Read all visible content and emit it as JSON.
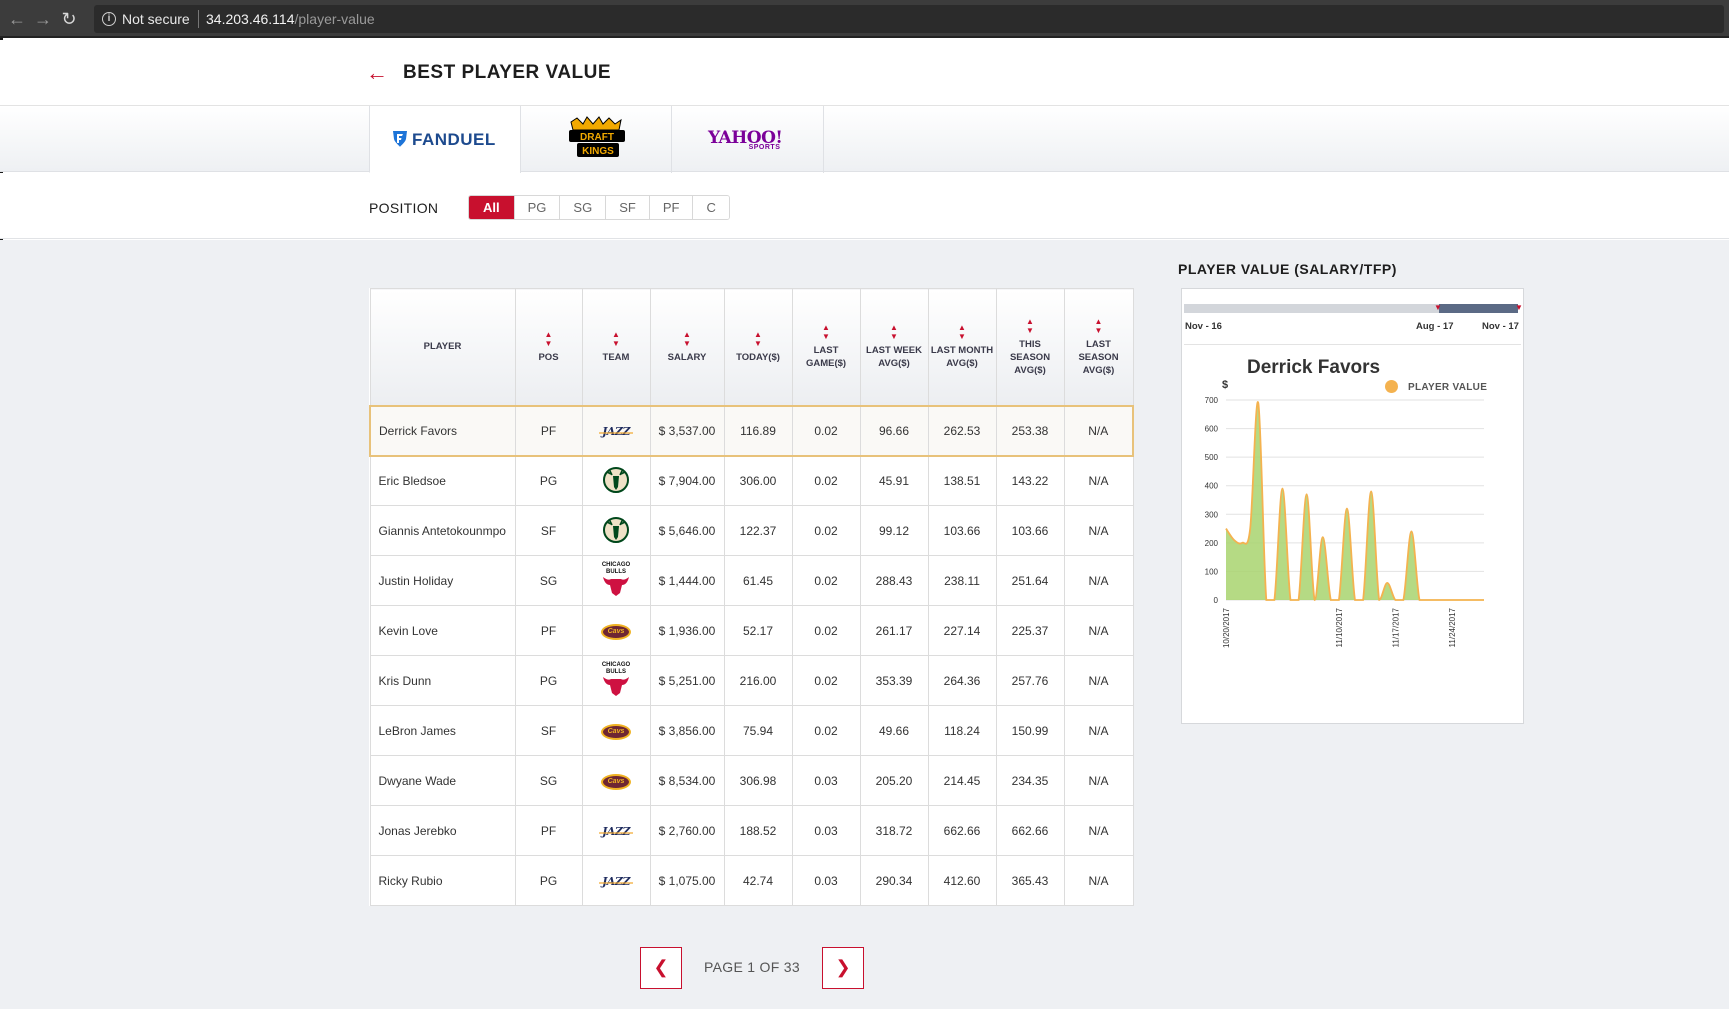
{
  "browser": {
    "security_label": "Not secure",
    "host": "34.203.46.114",
    "path": "/player-value"
  },
  "header": {
    "back_icon": "arrow-left-icon",
    "title": "BEST PLAYER VALUE"
  },
  "providers": [
    {
      "name": "FANDUEL",
      "active": true
    },
    {
      "name": "DRAFT KINGS",
      "active": false
    },
    {
      "name": "YAHOO!",
      "sub": "SPORTS",
      "active": false
    }
  ],
  "filter": {
    "label": "POSITION",
    "options": [
      "All",
      "PG",
      "SG",
      "SF",
      "PF",
      "C"
    ],
    "selected": "All"
  },
  "table": {
    "columns": [
      "PLAYER",
      "POS",
      "TEAM",
      "SALARY",
      "TODAY($)",
      "LAST GAME($)",
      "LAST WEEK AVG($)",
      "LAST MONTH AVG($)",
      "THIS SEASON AVG($)",
      "LAST SEASON AVG($)"
    ],
    "rows": [
      {
        "player": "Derrick Favors",
        "pos": "PF",
        "team": "jazz",
        "team_text": "JAZZ",
        "salary": "$ 3,537.00",
        "today": "116.89",
        "last_game": "0.02",
        "last_week": "96.66",
        "last_month": "262.53",
        "this_season": "253.38",
        "last_season": "N/A",
        "selected": true
      },
      {
        "player": "Eric Bledsoe",
        "pos": "PG",
        "team": "bucks",
        "team_text": "",
        "salary": "$ 7,904.00",
        "today": "306.00",
        "last_game": "0.02",
        "last_week": "45.91",
        "last_month": "138.51",
        "this_season": "143.22",
        "last_season": "N/A"
      },
      {
        "player": "Giannis Antetokounmpo",
        "pos": "SF",
        "team": "bucks",
        "team_text": "",
        "salary": "$ 5,646.00",
        "today": "122.37",
        "last_game": "0.02",
        "last_week": "99.12",
        "last_month": "103.66",
        "this_season": "103.66",
        "last_season": "N/A"
      },
      {
        "player": "Justin Holiday",
        "pos": "SG",
        "team": "bulls",
        "team_text": "CHICAGO BULLS",
        "salary": "$ 1,444.00",
        "today": "61.45",
        "last_game": "0.02",
        "last_week": "288.43",
        "last_month": "238.11",
        "this_season": "251.64",
        "last_season": "N/A"
      },
      {
        "player": "Kevin Love",
        "pos": "PF",
        "team": "cavs",
        "team_text": "Cavs",
        "salary": "$ 1,936.00",
        "today": "52.17",
        "last_game": "0.02",
        "last_week": "261.17",
        "last_month": "227.14",
        "this_season": "225.37",
        "last_season": "N/A"
      },
      {
        "player": "Kris Dunn",
        "pos": "PG",
        "team": "bulls",
        "team_text": "CHICAGO BULLS",
        "salary": "$ 5,251.00",
        "today": "216.00",
        "last_game": "0.02",
        "last_week": "353.39",
        "last_month": "264.36",
        "this_season": "257.76",
        "last_season": "N/A"
      },
      {
        "player": "LeBron James",
        "pos": "SF",
        "team": "cavs",
        "team_text": "Cavs",
        "salary": "$ 3,856.00",
        "today": "75.94",
        "last_game": "0.02",
        "last_week": "49.66",
        "last_month": "118.24",
        "this_season": "150.99",
        "last_season": "N/A"
      },
      {
        "player": "Dwyane Wade",
        "pos": "SG",
        "team": "cavs",
        "team_text": "Cavs",
        "salary": "$ 8,534.00",
        "today": "306.98",
        "last_game": "0.03",
        "last_week": "205.20",
        "last_month": "214.45",
        "this_season": "234.35",
        "last_season": "N/A"
      },
      {
        "player": "Jonas Jerebko",
        "pos": "PF",
        "team": "jazz",
        "team_text": "JAZZ",
        "salary": "$ 2,760.00",
        "today": "188.52",
        "last_game": "0.03",
        "last_week": "318.72",
        "last_month": "662.66",
        "this_season": "662.66",
        "last_season": "N/A"
      },
      {
        "player": "Ricky Rubio",
        "pos": "PG",
        "team": "jazz",
        "team_text": "JAZZ",
        "salary": "$ 1,075.00",
        "today": "42.74",
        "last_game": "0.03",
        "last_week": "290.34",
        "last_month": "412.60",
        "this_season": "365.43",
        "last_season": "N/A"
      }
    ]
  },
  "pagination": {
    "text": "PAGE 1 OF 33",
    "prev_icon": "chevron-left-icon",
    "next_icon": "chevron-right-icon"
  },
  "panel": {
    "title": "PLAYER VALUE (SALARY/TFP)",
    "range": {
      "start": "Nov - 16",
      "sel_start": "Aug - 17",
      "end": "Nov - 17"
    }
  },
  "chart_data": {
    "type": "area",
    "title": "Derrick Favors",
    "ylabel": "$",
    "ylim": [
      0,
      700
    ],
    "yticks": [
      0,
      100,
      200,
      300,
      400,
      500,
      600,
      700
    ],
    "x_tick_labels": [
      "10/20/2017",
      "11/10/2017",
      "11/17/2017",
      "11/24/2017"
    ],
    "series": [
      {
        "name": "PLAYER VALUE",
        "color": "#f4b24f",
        "fill": "#a8d46f",
        "x": [
          "10/20/2017",
          "10/21/2017",
          "10/22/2017",
          "10/23/2017",
          "10/24/2017",
          "10/25/2017",
          "10/26/2017",
          "11/3/2017",
          "11/4/2017",
          "11/5/2017",
          "11/6/2017",
          "11/7/2017",
          "11/8/2017",
          "11/9/2017",
          "11/10/2017",
          "11/11/2017",
          "11/12/2017",
          "11/13/2017",
          "11/14/2017",
          "11/15/2017",
          "11/16/2017",
          "11/17/2017",
          "11/18/2017",
          "11/19/2017",
          "11/20/2017",
          "11/21/2017",
          "11/22/2017",
          "11/23/2017",
          "11/24/2017",
          "11/25/2017",
          "11/26/2017",
          "11/27/2017",
          "11/28/2017"
        ],
        "values": [
          250,
          210,
          200,
          250,
          690,
          0,
          0,
          390,
          0,
          0,
          370,
          0,
          220,
          0,
          0,
          320,
          0,
          0,
          380,
          0,
          60,
          0,
          0,
          240,
          0,
          0,
          0,
          0,
          0,
          0,
          0,
          0,
          0
        ]
      }
    ]
  }
}
